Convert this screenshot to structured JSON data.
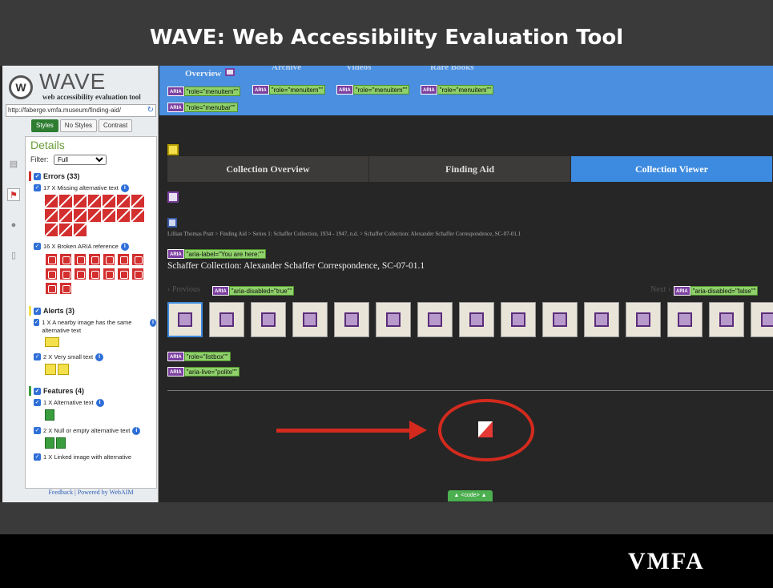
{
  "slide": {
    "title": "WAVE: Web Accessibility Evaluation Tool",
    "footer_logo": "VMFA"
  },
  "wave": {
    "logo_word": "WAVE",
    "logo_sub": "web accessibility evaluation tool",
    "url": "http://faberge.vmfa.museum/finding-aid/",
    "view_tabs": [
      "Styles",
      "No Styles",
      "Contrast"
    ],
    "details_title": "Details",
    "filter_label": "Filter:",
    "filter_value": "Full",
    "errors": {
      "label": "Errors (33)",
      "items": [
        "17 X Missing alternative text",
        "16 X Broken ARIA reference"
      ]
    },
    "alerts": {
      "label": "Alerts (3)",
      "items": [
        "1 X A nearby image has the same alternative text",
        "2 X Very small text"
      ]
    },
    "features": {
      "label": "Features (4)",
      "items": [
        "1 X Alternative text",
        "2 X Null or empty alternative text",
        "1 X Linked image with alternative"
      ]
    },
    "footer": "Feedback | Powered by WebAIM",
    "colors": {
      "error": "#d32f2f",
      "alert": "#f4e04d",
      "feature": "#3a9d3e",
      "aria": "#7b3fa0"
    }
  },
  "site": {
    "nav": [
      "Overview",
      "Archive",
      "Videos",
      "Rare Books"
    ],
    "aria_tags": {
      "menuitem": "\"role=\"menuitem\"\"",
      "menubar": "\"role=\"menubar\"\"",
      "aria_label": "\"aria-label=\"You are here:\"\"",
      "aria_disabled_true": "\"aria-disabled=\"true\"\"",
      "aria_disabled_false": "\"aria-disabled=\"false\"\"",
      "listbox": "\"role=\"listbox\"\"",
      "aria_live": "\"aria-live=\"polite\"\"",
      "aria_word": "ARIA"
    },
    "tabs": [
      "Collection Overview",
      "Finding Aid",
      "Collection Viewer"
    ],
    "breadcrumb": "Lillian Thomas Pratt  >  Finding Aid  >  Series 1: Schaffer Collection, 1934 - 1947, n.d.  >  Schaffer Collection: Alexander Schaffer Correspondence, SC-07-01.1",
    "collection_title": "Schaffer Collection: Alexander Schaffer Correspondence, SC-07-01.1",
    "previous": "‹ Previous",
    "next": "Next ›",
    "code_button": "▲ <code> ▲"
  }
}
